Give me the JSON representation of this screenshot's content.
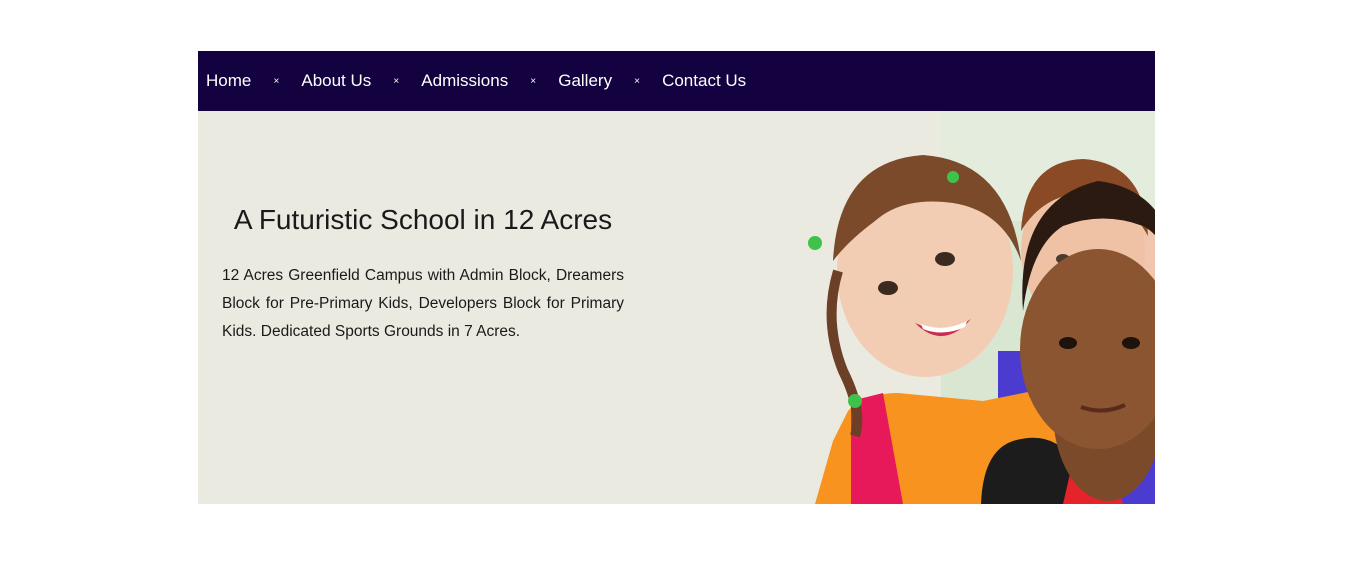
{
  "nav": {
    "items": [
      {
        "label": "Home"
      },
      {
        "label": "About Us"
      },
      {
        "label": "Admissions"
      },
      {
        "label": "Gallery"
      },
      {
        "label": "Contact Us"
      }
    ],
    "separator": "×"
  },
  "hero": {
    "title": "A Futuristic School in 12 Acres",
    "description": "12 Acres Greenfield Campus with Admin Block, Dreamers Block for Pre-Primary Kids, Developers Block for Primary Kids. Dedicated Sports Grounds in 7 Acres."
  },
  "colors": {
    "nav_background": "#13023f",
    "hero_background": "#ebeae1"
  }
}
